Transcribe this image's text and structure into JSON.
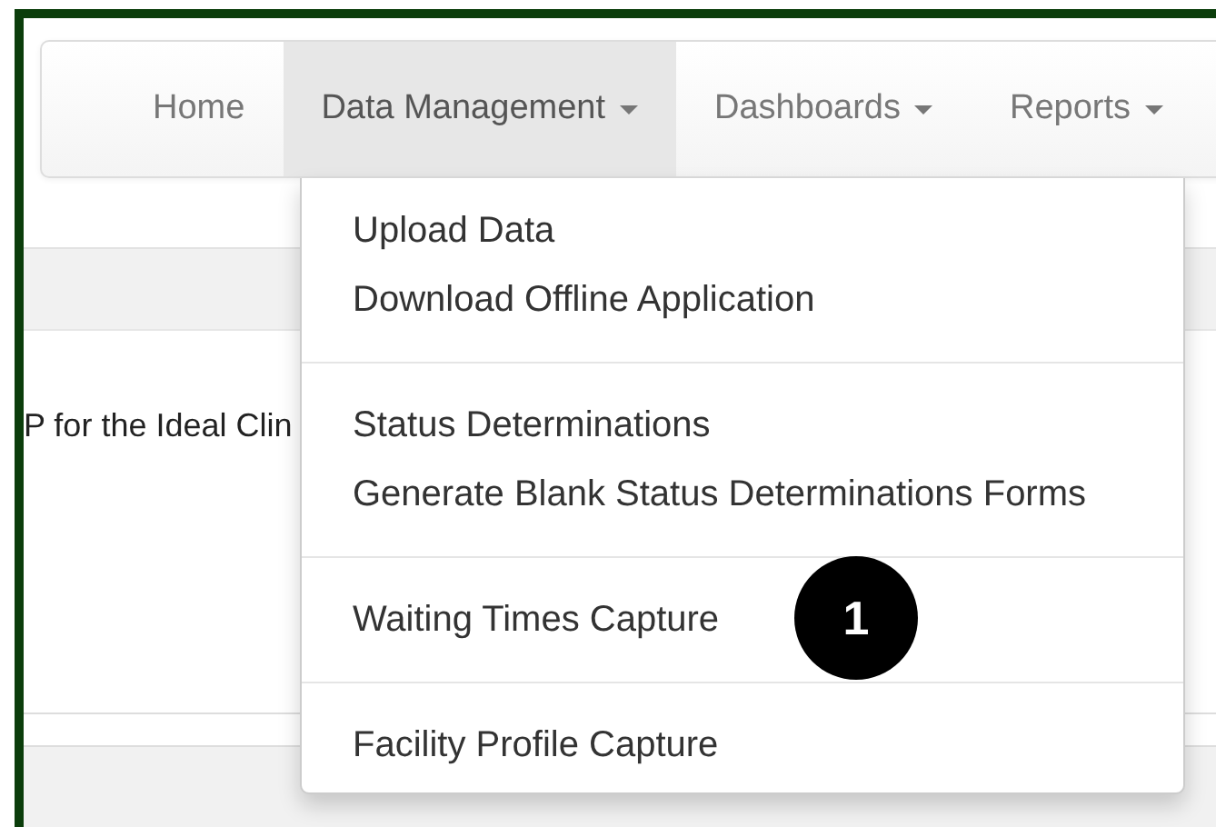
{
  "navbar": {
    "items": [
      {
        "label": "Home",
        "kind": "link",
        "selected": false
      },
      {
        "label": "Data Management",
        "kind": "dropdown",
        "selected": true
      },
      {
        "label": "Dashboards",
        "kind": "dropdown",
        "selected": false
      },
      {
        "label": "Reports",
        "kind": "dropdown",
        "selected": false
      }
    ]
  },
  "content": {
    "text": "P for the Ideal Clin"
  },
  "dropdown_menu": {
    "groups": [
      {
        "items": [
          "Upload Data",
          "Download Offline Application"
        ]
      },
      {
        "items": [
          "Status Determinations",
          "Generate Blank Status Determinations Forms"
        ]
      },
      {
        "items": [
          "Waiting Times Capture"
        ]
      },
      {
        "items": [
          "Facility Profile Capture"
        ]
      }
    ]
  },
  "callout_badge": {
    "label": "1"
  }
}
